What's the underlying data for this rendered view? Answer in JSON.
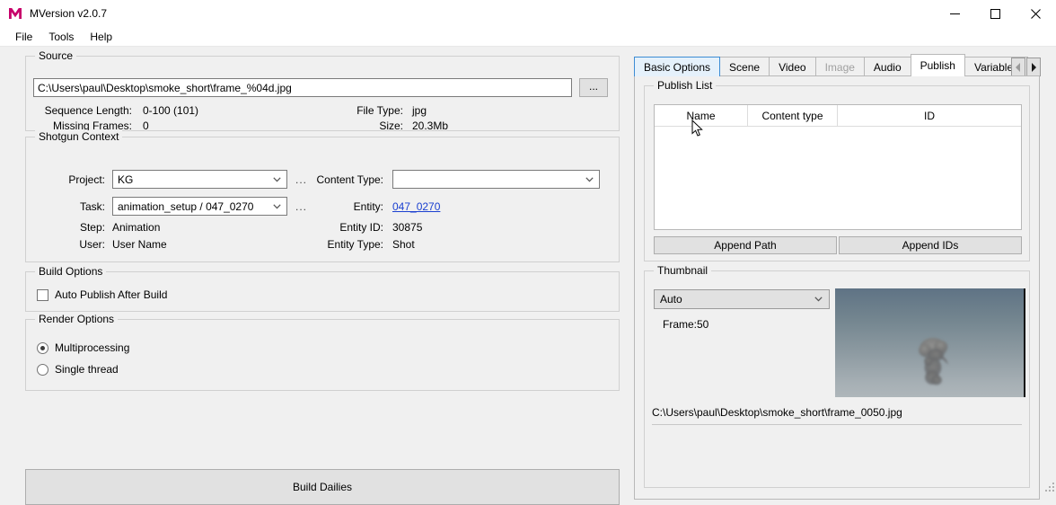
{
  "window": {
    "title": "MVersion v2.0.7",
    "logo_icon": "m-logo-icon",
    "logo_color": "#c7006a",
    "minimize_label": "—",
    "maximize_label": "□",
    "close_label": "✕"
  },
  "menu": {
    "items": [
      {
        "label": "File"
      },
      {
        "label": "Tools"
      },
      {
        "label": "Help"
      }
    ]
  },
  "source": {
    "group_title": "Source",
    "path_value": "C:\\Users\\paul\\Desktop\\smoke_short\\frame_%04d.jpg",
    "browse_label": "...",
    "sequence_length_label": "Sequence Length:",
    "sequence_length_value": "0-100 (101)",
    "missing_frames_label": "Missing Frames:",
    "missing_frames_value": "0",
    "file_type_label": "File Type:",
    "file_type_value": "jpg",
    "size_label": "Size:",
    "size_value": "20.3Mb"
  },
  "shotgun": {
    "group_title": "Shotgun Context",
    "project_label": "Project:",
    "project_value": "KG",
    "project_more": "...",
    "task_label": "Task:",
    "task_value": "animation_setup / 047_0270",
    "task_more": "...",
    "step_label": "Step:",
    "step_value": "Animation",
    "user_label": "User:",
    "user_value": "User Name",
    "content_type_label": "Content Type:",
    "content_type_value": "",
    "entity_label": "Entity:",
    "entity_value": "047_0270",
    "entity_id_label": "Entity ID:",
    "entity_id_value": "30875",
    "entity_type_label": "Entity Type:",
    "entity_type_value": "Shot"
  },
  "build_options": {
    "group_title": "Build Options",
    "auto_publish_label": "Auto Publish After Build",
    "auto_publish_checked": false
  },
  "render_options": {
    "group_title": "Render Options",
    "multiprocessing_label": "Multiprocessing",
    "multiprocessing_selected": true,
    "single_thread_label": "Single thread",
    "single_thread_selected": false
  },
  "build_dailies": {
    "label": "Build Dailies"
  },
  "tabs": {
    "items": [
      {
        "label": "Basic Options",
        "state": "hover"
      },
      {
        "label": "Scene",
        "state": "normal"
      },
      {
        "label": "Video",
        "state": "normal"
      },
      {
        "label": "Image",
        "state": "disabled"
      },
      {
        "label": "Audio",
        "state": "normal"
      },
      {
        "label": "Publish",
        "state": "active"
      },
      {
        "label": "Variables",
        "state": "normal"
      }
    ],
    "scroll_left_icon": "chevron-left-icon",
    "scroll_right_icon": "chevron-right-icon"
  },
  "publish_list": {
    "group_title": "Publish List",
    "columns": [
      "Name",
      "Content type",
      "ID"
    ],
    "rows": [],
    "append_path_label": "Append Path",
    "append_ids_label": "Append IDs"
  },
  "thumbnail": {
    "group_title": "Thumbnail",
    "mode_value": "Auto",
    "frame_label": "Frame:",
    "frame_value": "50",
    "image_path": "C:\\Users\\paul\\Desktop\\smoke_short\\frame_0050.jpg",
    "image_alt": "smoke-plume-thumbnail"
  },
  "colors": {
    "window_bg": "#f0f0f0",
    "accent_blue": "#0078d7",
    "link_blue": "#1a3fd0",
    "hover_tab": "#e5f1fb",
    "logo": "#c7006a"
  }
}
